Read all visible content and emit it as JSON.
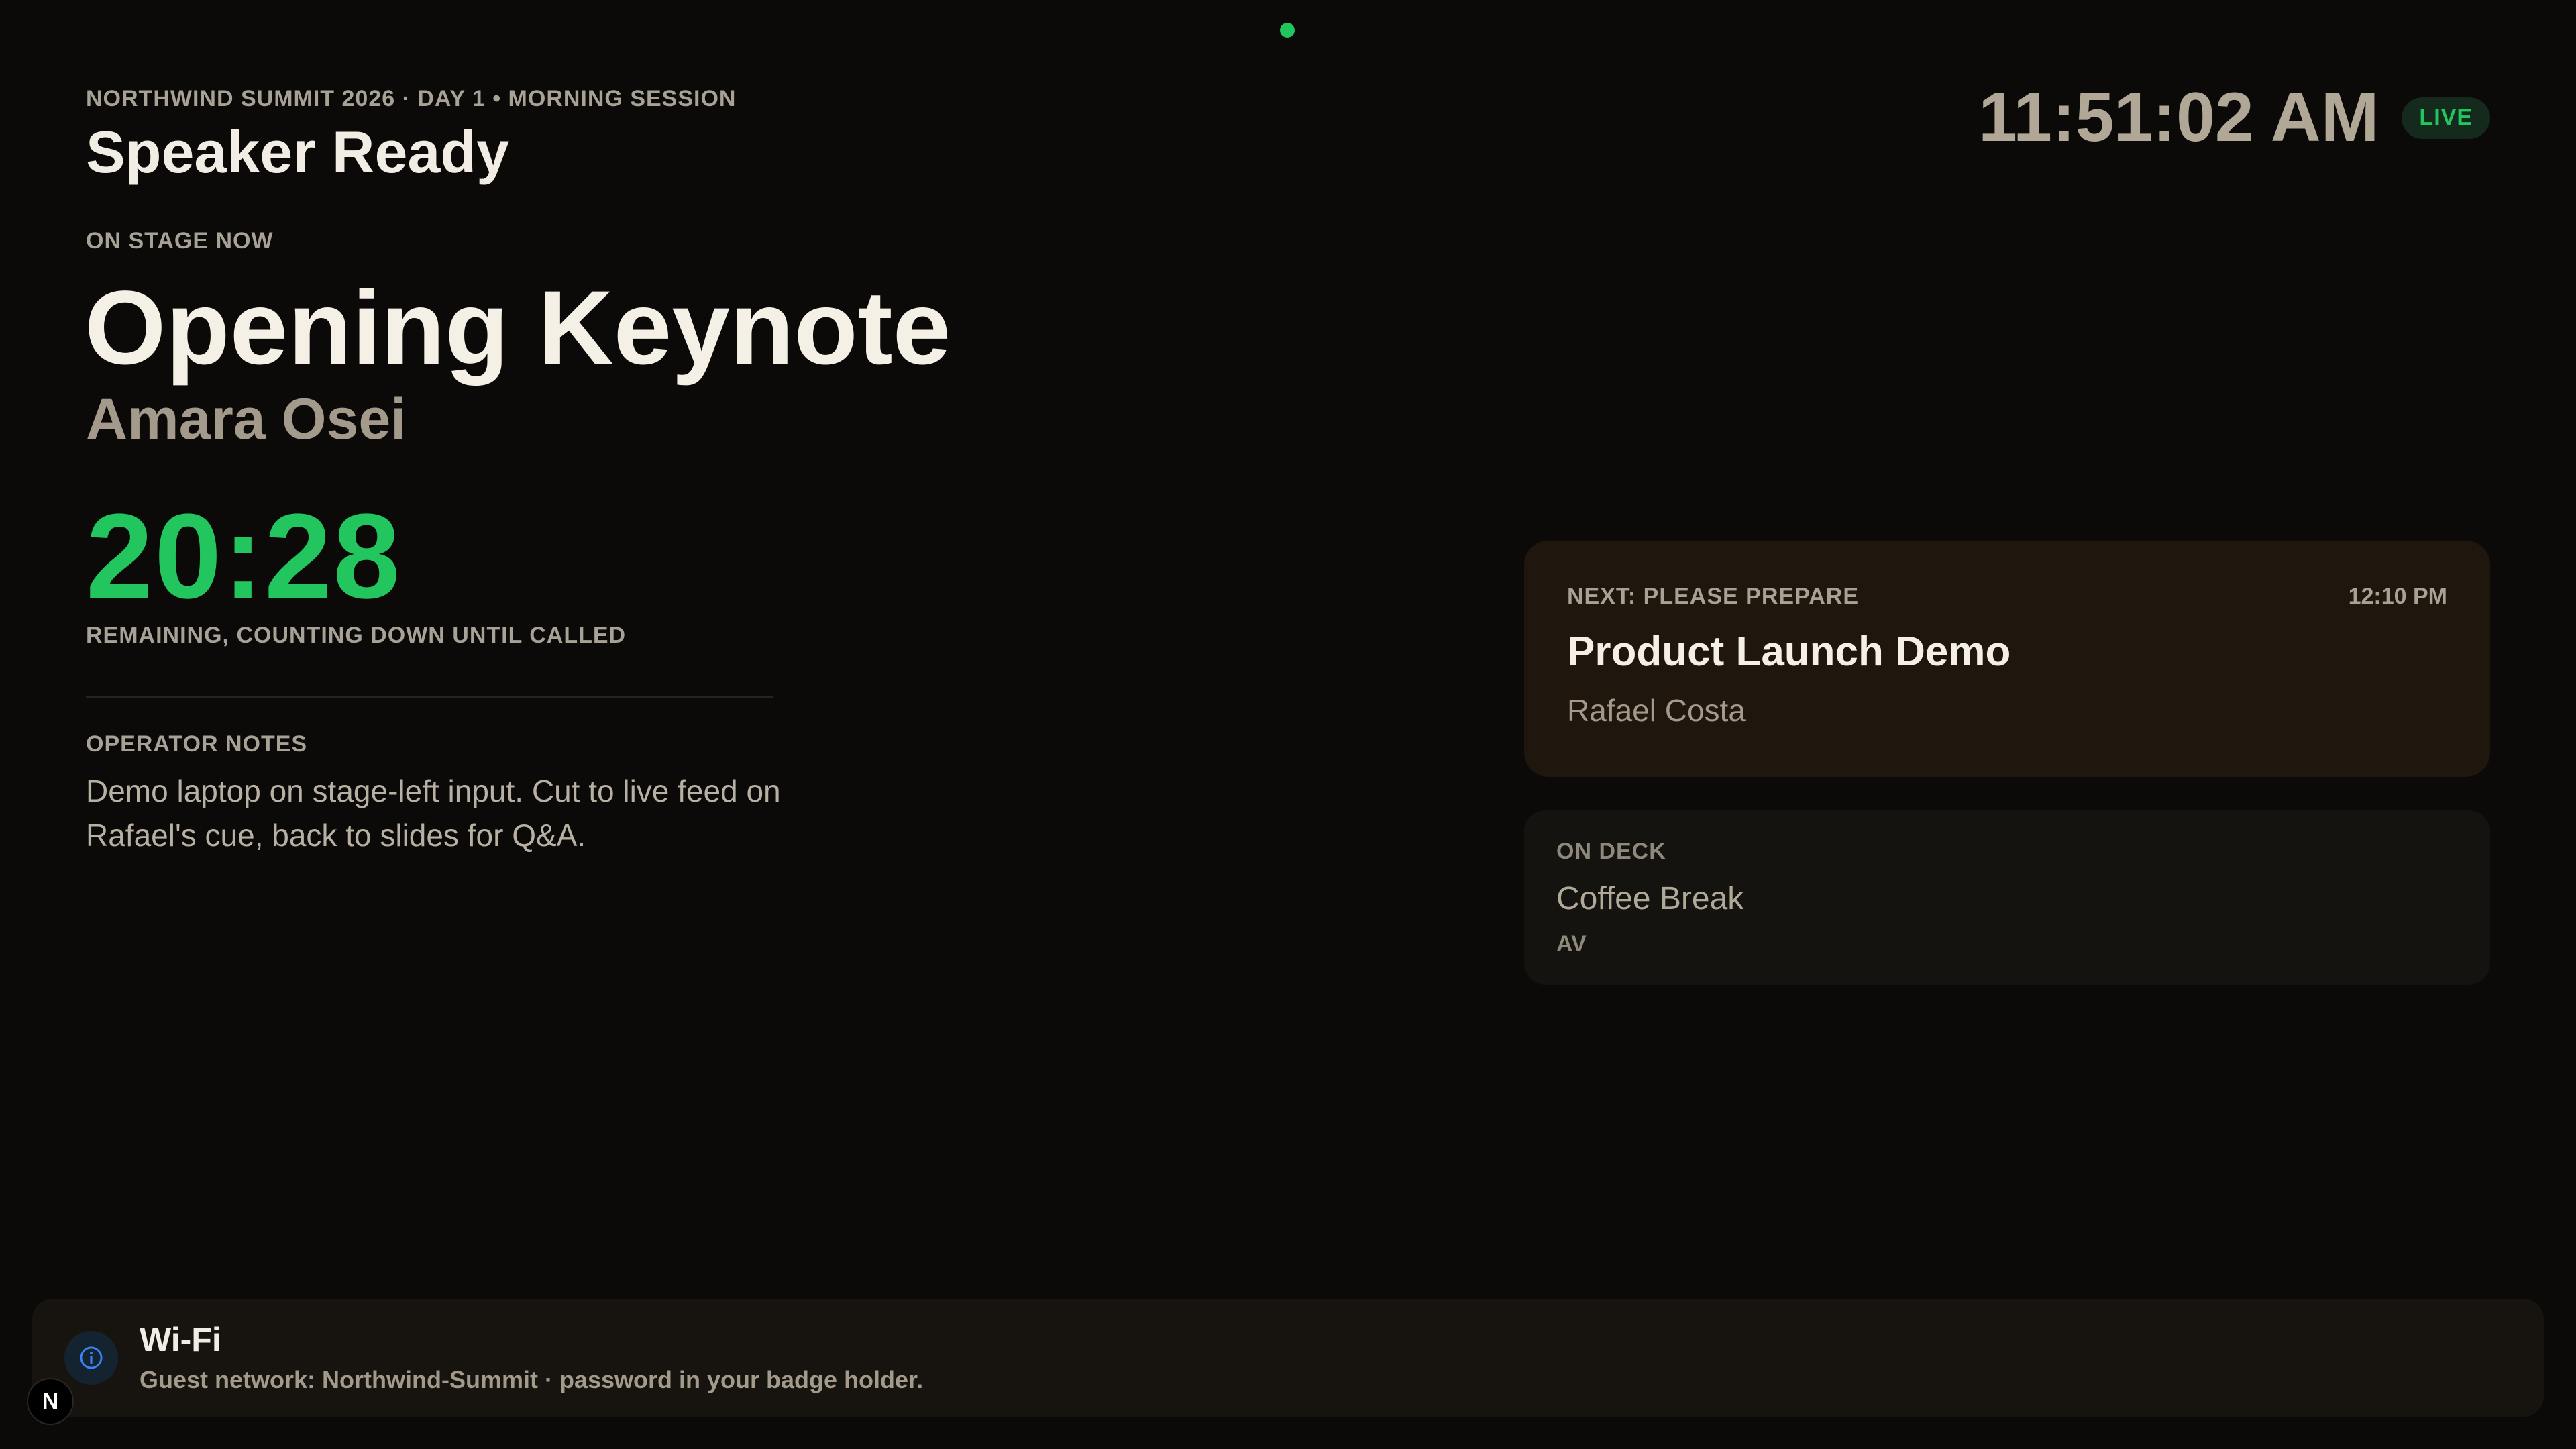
{
  "header": {
    "eyebrow": "NORTHWIND SUMMIT 2026 · DAY 1 • MORNING SESSION",
    "title": "Speaker Ready",
    "clock": "11:51:02 AM",
    "live_badge": "LIVE"
  },
  "current": {
    "label": "ON STAGE NOW",
    "title": "Opening Keynote",
    "speaker": "Amara Osei",
    "countdown": "20:28",
    "countdown_caption": "REMAINING, COUNTING DOWN UNTIL CALLED"
  },
  "notes": {
    "label": "OPERATOR NOTES",
    "text": "Demo laptop on stage-left input. Cut to live feed on Rafael's cue, back to slides for Q&A."
  },
  "next": {
    "label": "NEXT: PLEASE PREPARE",
    "time": "12:10 PM",
    "title": "Product Launch Demo",
    "speaker": "Rafael Costa"
  },
  "on_deck": {
    "label": "ON DECK",
    "title": "Coffee Break",
    "subtitle": "AV"
  },
  "banner": {
    "icon": "info-icon",
    "title": "Wi-Fi",
    "text": "Guest network: Northwind-Summit · password in your badge holder."
  },
  "app_badge": {
    "letter": "N"
  },
  "colors": {
    "background": "#0b0a08",
    "accent_green": "#22c55e",
    "next_card": "#1f170e",
    "info_blue": "#3b82f6"
  }
}
